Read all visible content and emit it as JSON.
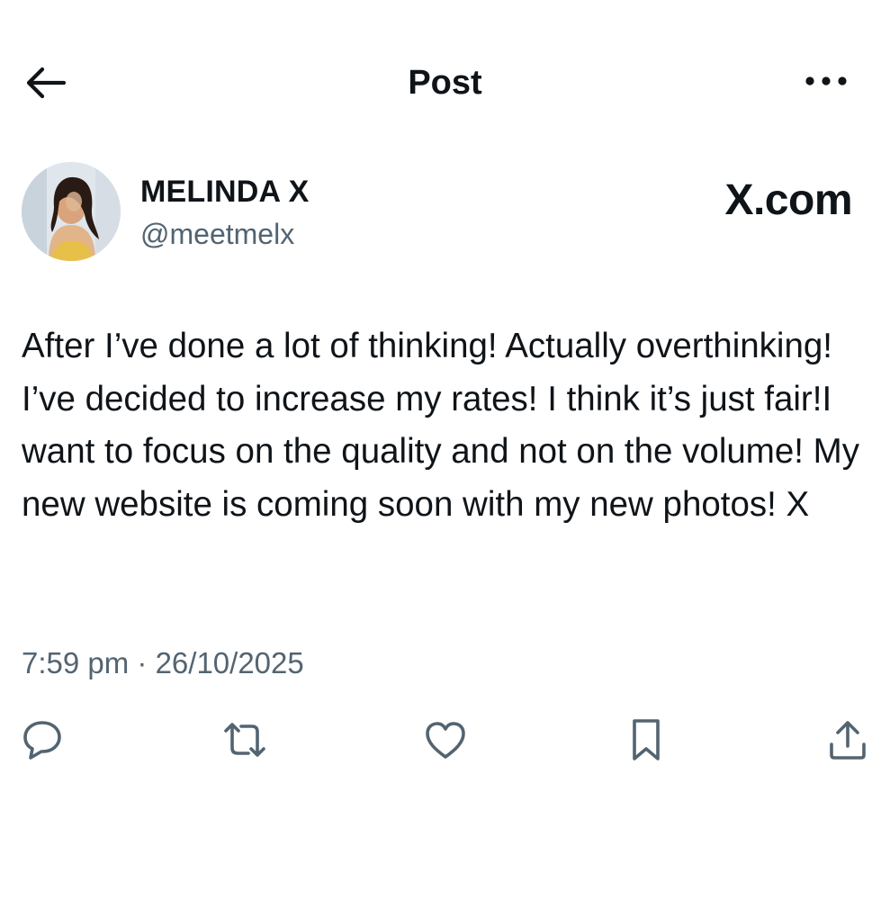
{
  "header": {
    "title": "Post"
  },
  "author": {
    "display_name": "MELINDA X",
    "handle": "@meetmelx"
  },
  "brand_label": "X.com",
  "post": {
    "text": "After I’ve done a lot of thinking! Actually overthinking! I’ve decided to increase my rates! I think it’s just fair!I want to focus on the quality and not on the volume! My new website is coming soon with my new photos! X",
    "timestamp": "7:59 pm · 26/10/2025"
  },
  "icons": {
    "back": "arrow-left-icon",
    "more": "ellipsis-icon",
    "reply": "reply-bubble-icon",
    "repost": "repost-icon",
    "like": "heart-icon",
    "bookmark": "bookmark-icon",
    "share": "share-upload-icon"
  },
  "colors": {
    "text_primary": "#0f1419",
    "text_secondary": "#536471",
    "icon": "#536471",
    "background": "#ffffff"
  }
}
